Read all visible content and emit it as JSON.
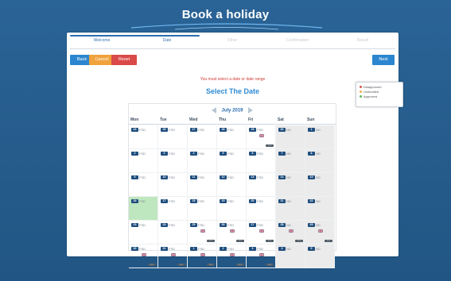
{
  "header": {
    "title": "Book a holiday"
  },
  "steps": [
    {
      "label": "Welcome",
      "state": "done"
    },
    {
      "label": "Date",
      "state": "active"
    },
    {
      "label": "Other",
      "state": "disabled"
    },
    {
      "label": "Confirmation",
      "state": "disabled"
    },
    {
      "label": "Result",
      "state": "disabled"
    }
  ],
  "buttons": {
    "back": "Back",
    "cancel": "Cancel",
    "reset": "Reset",
    "next": "Next"
  },
  "messages": {
    "error": "You must select a date or date range",
    "select_title": "Select The Date"
  },
  "legend": [
    {
      "label": "Disapproved",
      "color": "#d9534f"
    },
    {
      "label": "Undecided",
      "color": "#f0ad4e"
    },
    {
      "label": "Approved",
      "color": "#5cb85c"
    }
  ],
  "calendar": {
    "month_label": "July 2019",
    "day_names": [
      "Mon",
      "Tue",
      "Wed",
      "Thu",
      "Fri",
      "Sat",
      "Sun"
    ],
    "more_label": "• • •",
    "weeks": [
      [
        {
          "num": "24",
          "tag": "FSD",
          "weekend": false,
          "flag": false
        },
        {
          "num": "25",
          "tag": "FSD",
          "weekend": false,
          "flag": false
        },
        {
          "num": "27",
          "tag": "FSD",
          "weekend": false,
          "flag": false
        },
        {
          "num": "28",
          "tag": "FSD",
          "weekend": false,
          "flag": false
        },
        {
          "num": "29",
          "tag": "FSD",
          "weekend": false,
          "flag": true,
          "more": true
        },
        {
          "num": "30",
          "tag": "ND",
          "weekend": true,
          "flag": false
        },
        {
          "num": "1",
          "tag": "ND",
          "weekend": true,
          "flag": false
        }
      ],
      [
        {
          "num": "2",
          "tag": "FSD",
          "weekend": false,
          "flag": false
        },
        {
          "num": "3",
          "tag": "FSD",
          "weekend": false,
          "flag": false
        },
        {
          "num": "4",
          "tag": "FSD",
          "weekend": false,
          "flag": false
        },
        {
          "num": "5",
          "tag": "FSD",
          "weekend": false,
          "flag": false
        },
        {
          "num": "6",
          "tag": "FSD",
          "weekend": false,
          "flag": false
        },
        {
          "num": "7",
          "tag": "ND",
          "weekend": true,
          "flag": false
        },
        {
          "num": "8",
          "tag": "ND",
          "weekend": true,
          "flag": false
        }
      ],
      [
        {
          "num": "9",
          "tag": "FSD",
          "weekend": false,
          "flag": false
        },
        {
          "num": "10",
          "tag": "FSD",
          "weekend": false,
          "flag": false
        },
        {
          "num": "11",
          "tag": "FSD",
          "weekend": false,
          "flag": false
        },
        {
          "num": "12",
          "tag": "FSD",
          "weekend": false,
          "flag": false
        },
        {
          "num": "13",
          "tag": "FSD",
          "weekend": false,
          "flag": false
        },
        {
          "num": "14",
          "tag": "ND",
          "weekend": true,
          "flag": false
        },
        {
          "num": "15",
          "tag": "ND",
          "weekend": true,
          "flag": false
        }
      ],
      [
        {
          "num": "16",
          "tag": "FSD",
          "weekend": false,
          "flag": false,
          "highlight": true
        },
        {
          "num": "17",
          "tag": "FSD",
          "weekend": false,
          "flag": false
        },
        {
          "num": "18",
          "tag": "FSD",
          "weekend": false,
          "flag": false
        },
        {
          "num": "19",
          "tag": "FSD",
          "weekend": false,
          "flag": false
        },
        {
          "num": "20",
          "tag": "FSD",
          "weekend": false,
          "flag": false
        },
        {
          "num": "21",
          "tag": "ND",
          "weekend": true,
          "flag": false
        },
        {
          "num": "22",
          "tag": "ND",
          "weekend": true,
          "flag": false
        }
      ],
      [
        {
          "num": "23",
          "tag": "FSD",
          "weekend": false,
          "flag": false
        },
        {
          "num": "24",
          "tag": "FSD",
          "weekend": false,
          "flag": false
        },
        {
          "num": "25",
          "tag": "FSD",
          "weekend": false,
          "flag": true,
          "more": true
        },
        {
          "num": "26",
          "tag": "FSD",
          "weekend": false,
          "flag": true,
          "more": true
        },
        {
          "num": "27",
          "tag": "FSD",
          "weekend": false,
          "flag": true,
          "more": true
        },
        {
          "num": "28",
          "tag": "ND",
          "weekend": true,
          "flag": true,
          "more": true
        },
        {
          "num": "29",
          "tag": "ND",
          "weekend": true,
          "flag": true,
          "more": true
        }
      ],
      [
        {
          "num": "30",
          "tag": "FSD",
          "weekend": false,
          "flag": true,
          "more": true
        },
        {
          "num": "31",
          "tag": "FSD",
          "weekend": false,
          "flag": true,
          "more": true
        },
        {
          "num": "1",
          "tag": "FSD",
          "weekend": false,
          "flag": true,
          "more": true
        },
        {
          "num": "2",
          "tag": "FSD",
          "weekend": false,
          "flag": true,
          "more": true
        },
        {
          "num": "3",
          "tag": "FSD",
          "weekend": false,
          "flag": true,
          "more": true
        },
        {
          "num": "4",
          "tag": "ND",
          "weekend": true,
          "flag": false
        },
        {
          "num": "5",
          "tag": "ND",
          "weekend": true,
          "flag": false
        }
      ]
    ]
  }
}
